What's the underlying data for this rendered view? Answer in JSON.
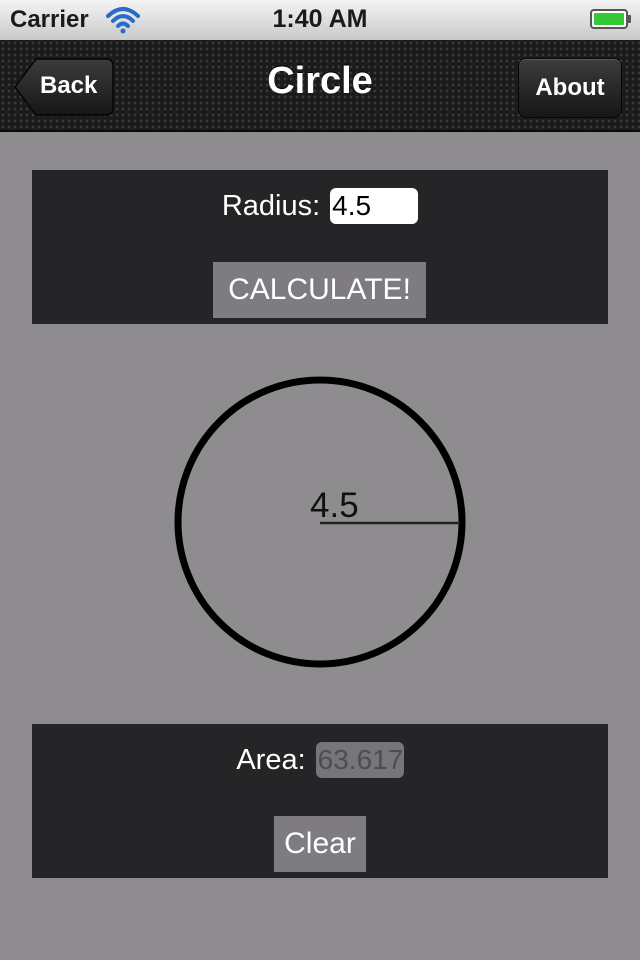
{
  "status_bar": {
    "carrier": "Carrier",
    "time": "1:40 AM",
    "icons": [
      "wifi-icon",
      "battery-icon"
    ]
  },
  "nav": {
    "title": "Circle",
    "back_label": "Back",
    "about_label": "About"
  },
  "input_panel": {
    "radius_label": "Radius:",
    "radius_value": "4.5",
    "calculate_label": "CALCULATE!"
  },
  "drawing": {
    "radius_text": "4.5"
  },
  "result_panel": {
    "area_label": "Area:",
    "area_value": "63.617",
    "clear_label": "Clear"
  },
  "colors": {
    "background": "#8e8c8f",
    "panel": "#252427",
    "button": "#7e7c80",
    "battery": "#35c935"
  }
}
